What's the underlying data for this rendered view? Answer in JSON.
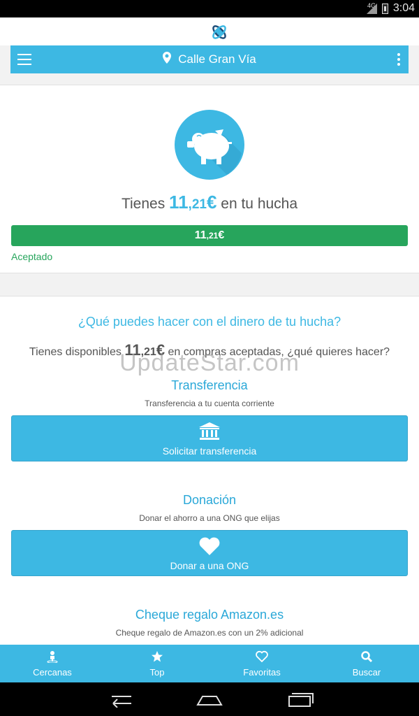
{
  "status_bar": {
    "network": "4G",
    "time": "3:04"
  },
  "toolbar": {
    "location": "Calle Gran Vía"
  },
  "balance": {
    "prefix": "Tienes",
    "amount_int": "11",
    "amount_dec": ",21",
    "currency": "€",
    "suffix": "en tu hucha",
    "progress_fraction": 1.0,
    "status": "Aceptado"
  },
  "options": {
    "question": "¿Qué puedes hacer con el dinero de tu hucha?",
    "available_prefix": "Tienes disponibles",
    "available_int": "11",
    "available_dec": ",21",
    "available_currency": "€",
    "available_suffix": "en compras aceptadas, ¿qué quieres hacer?",
    "watermark": "UpdateStar.com",
    "items": [
      {
        "title": "Transferencia",
        "desc": "Transferencia a tu cuenta corriente",
        "button": "Solicitar transferencia",
        "icon": "bank-icon"
      },
      {
        "title": "Donación",
        "desc": "Donar el ahorro a una ONG que elijas",
        "button": "Donar a una ONG",
        "icon": "heart-icon"
      },
      {
        "title": "Cheque regalo Amazon.es",
        "desc": "Cheque regalo de Amazon.es con un 2% adicional"
      }
    ]
  },
  "bottom_nav": [
    {
      "label": "Cercanas",
      "icon": "person-pin-icon"
    },
    {
      "label": "Top",
      "icon": "star-icon"
    },
    {
      "label": "Favoritas",
      "icon": "heart-outline-icon"
    },
    {
      "label": "Buscar",
      "icon": "search-icon"
    }
  ],
  "colors": {
    "accent": "#3db8e3",
    "success": "#27a55c"
  }
}
